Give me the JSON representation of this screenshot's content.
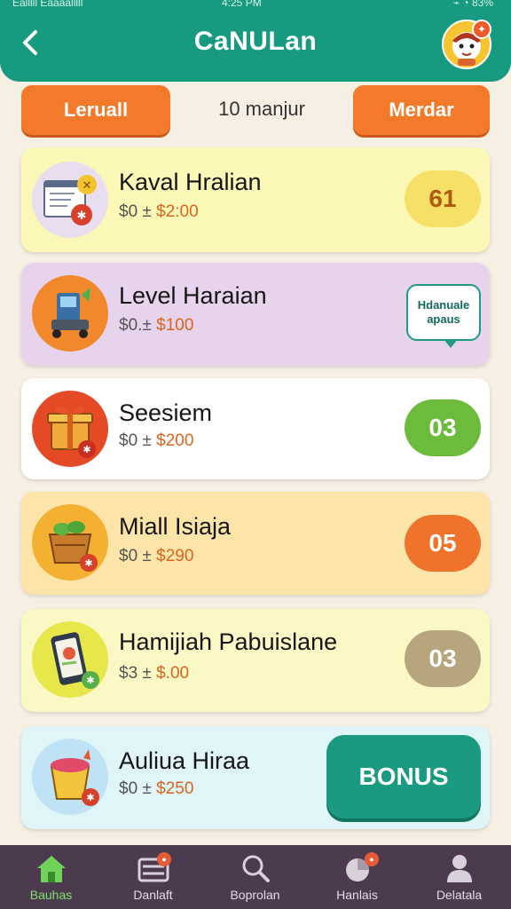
{
  "status_bar": {
    "left": "Ealllll Eaaaalllll",
    "time": "4:25 PM",
    "right": "⌁ ◔ 83%"
  },
  "header": {
    "title": "CaNULan"
  },
  "controls": {
    "left_label": "Leruall",
    "center_label": "10 manjur",
    "right_label": "Merdar"
  },
  "items": [
    {
      "name": "Kaval Hralian",
      "price_prefix": "$0 ± ",
      "price_amount": "$2:00",
      "badge": "61",
      "bg": "#fbf7b6",
      "badge_bg": "#f6e068",
      "badge_fg": "#b05a10",
      "icon": "document-icon",
      "icon_bg": "#e8def0"
    },
    {
      "name": "Level Haraian",
      "price_prefix": "$0.± ",
      "price_amount": "$100",
      "tag": "Hdanuale apaus",
      "bg": "#e8d3ec",
      "icon": "cart-machine-icon",
      "icon_bg": "#f1892c"
    },
    {
      "name": "Seesiem",
      "price_prefix": "$0 ± ",
      "price_amount": "$200",
      "badge": "03",
      "bg": "#ffffff",
      "badge_bg": "#6cbb3c",
      "badge_fg": "#ffffff",
      "icon": "gift-box-icon",
      "icon_bg": "#e54a26"
    },
    {
      "name": "Miall Isiaja",
      "price_prefix": "$0 ± ",
      "price_amount": "$290",
      "badge": "05",
      "bg": "#fde5aa",
      "badge_bg": "#f0732b",
      "badge_fg": "#ffffff",
      "icon": "basket-icon",
      "icon_bg": "#f4b030"
    },
    {
      "name": "Hamijiah Pabuislane",
      "price_prefix": "$3 ± ",
      "price_amount": "$.00",
      "badge": "03",
      "bg": "#fbf8c6",
      "badge_bg": "#b7a57e",
      "badge_fg": "#ffffff",
      "icon": "phone-icon",
      "icon_bg": "#e7e64a"
    },
    {
      "name": "Auliua Hiraa",
      "price_prefix": "$0 ± ",
      "price_amount": "$250",
      "button": "BONUS",
      "bg": "#dff5f7",
      "icon": "bucket-icon",
      "icon_bg": "#bfe3f4"
    }
  ],
  "nav": [
    {
      "label": "Bauhas",
      "icon": "home-icon",
      "active": true
    },
    {
      "label": "Danlaft",
      "icon": "inbox-icon",
      "active": false
    },
    {
      "label": "Boprolan",
      "icon": "search-icon",
      "active": false
    },
    {
      "label": "Hanlais",
      "icon": "chart-icon",
      "active": false
    },
    {
      "label": "Delatala",
      "icon": "profile-icon",
      "active": false
    }
  ],
  "colors": {
    "accent": "#179a7f",
    "orange": "#f27a2a",
    "nav_bg": "#4c3a4f"
  }
}
